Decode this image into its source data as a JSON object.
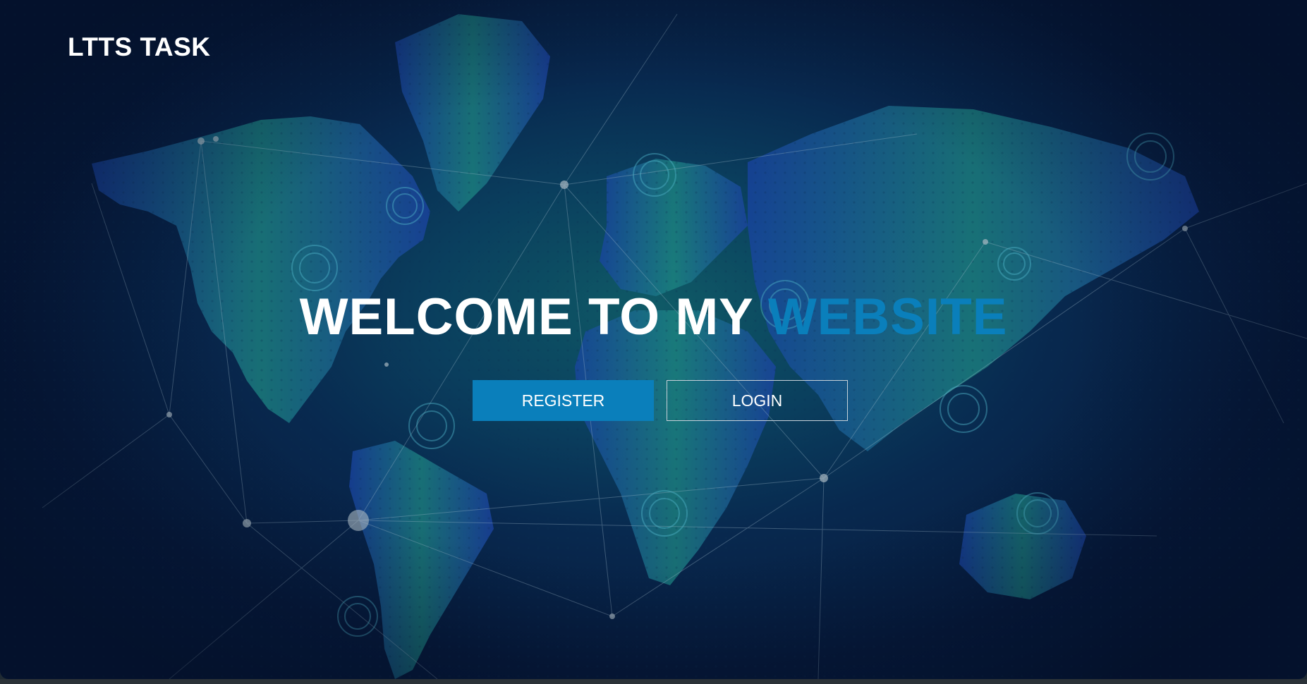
{
  "header": {
    "brand": "LTTS TASK"
  },
  "hero": {
    "title_main": "WELCOME TO MY",
    "title_accent": "WEBSITE"
  },
  "actions": {
    "register_label": "REGISTER",
    "login_label": "LOGIN"
  },
  "colors": {
    "accent": "#0a7fbb",
    "background_dark": "#061a3c",
    "map_green": "#1f8f86",
    "map_blue": "#1a4fa8"
  },
  "background": {
    "image": "world-map-network-background"
  }
}
